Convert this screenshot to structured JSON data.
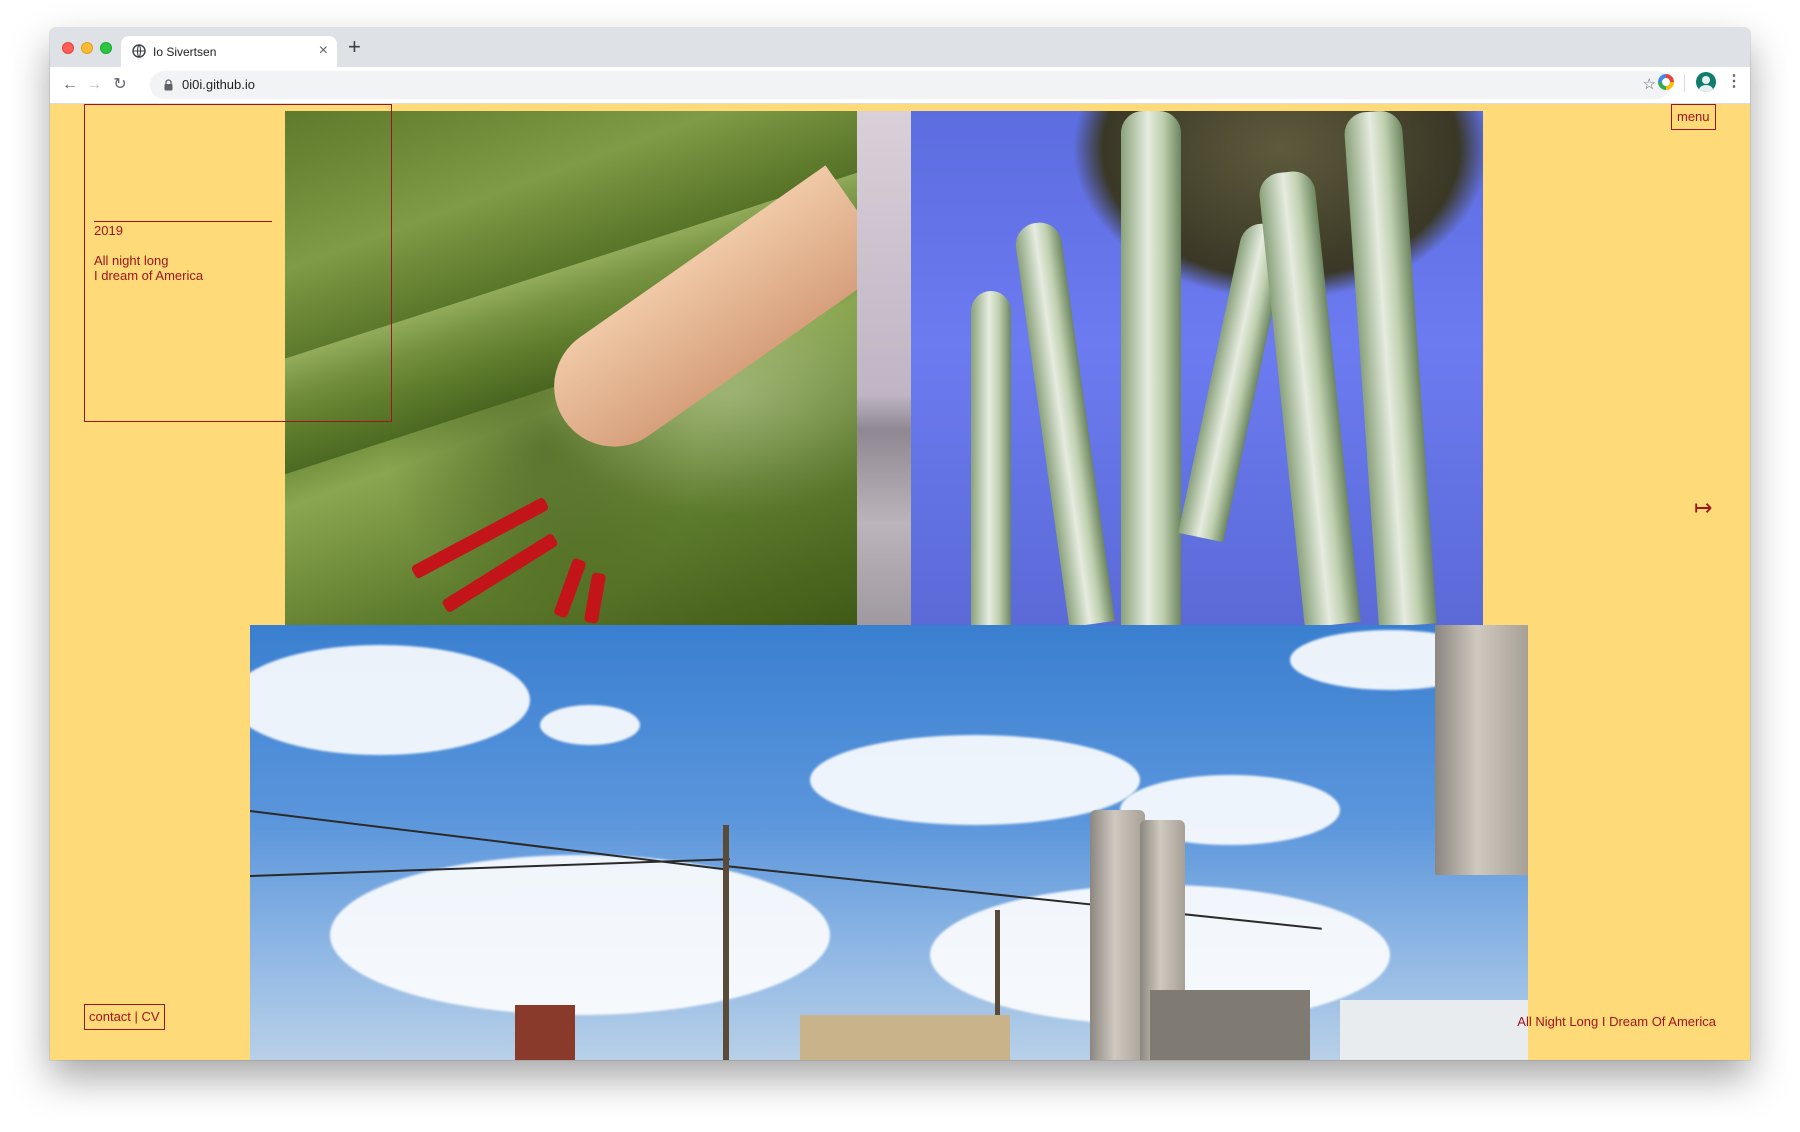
{
  "browser": {
    "tab_title": "Io Sivertsen",
    "tab_close": "×",
    "new_tab": "+",
    "url": "0i0i.github.io",
    "back": "←",
    "forward": "→",
    "reload": "↻",
    "bookmark": "☆",
    "menu": "⋮"
  },
  "page": {
    "year": "2019",
    "title_line1": "All night long",
    "title_line2": "I dream of America",
    "menu_label": "menu",
    "next_arrow": "↦",
    "contact_label": "contact | CV",
    "caption": "All Night Long I Dream Of America"
  },
  "colors": {
    "background": "#ffda79",
    "accent": "#a0151d"
  },
  "icons": [
    "globe-icon",
    "lock-icon",
    "star-icon",
    "extension-icon",
    "profile-avatar",
    "kebab-menu-icon",
    "arrow-right-bar-icon"
  ]
}
